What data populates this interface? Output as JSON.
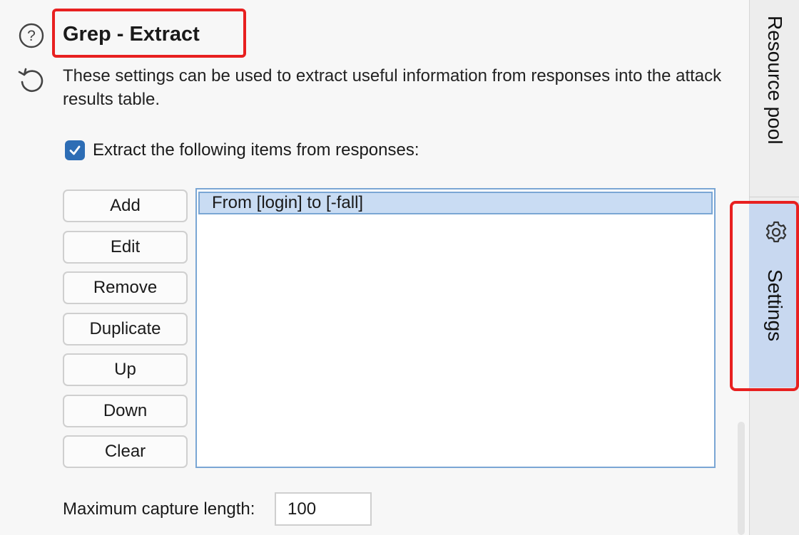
{
  "section": {
    "title": "Grep - Extract",
    "description": "These settings can be used to extract useful information from responses into the attack results table."
  },
  "extract": {
    "checkbox_label": "Extract the following items from responses:",
    "checked": true,
    "buttons": {
      "add": "Add",
      "edit": "Edit",
      "remove": "Remove",
      "duplicate": "Duplicate",
      "up": "Up",
      "down": "Down",
      "clear": "Clear"
    },
    "items": [
      "From [login] to [-fall]"
    ]
  },
  "capture": {
    "label": "Maximum capture length:",
    "value": "100"
  },
  "sidebar": {
    "tabs": [
      {
        "label": "Resource pool",
        "icon": ""
      },
      {
        "label": "Settings",
        "icon": "gear-icon",
        "active": true
      }
    ]
  },
  "colors": {
    "accent": "#2d6db5",
    "highlight_annotation": "#e82020",
    "selection": "#c9dcf3",
    "active_tab": "#c8d8f0"
  }
}
